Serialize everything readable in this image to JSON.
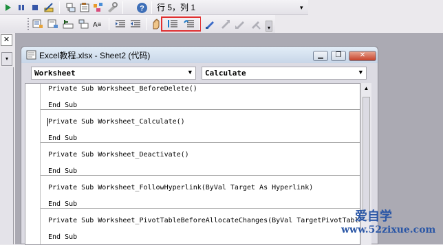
{
  "statusbar": {
    "position": "行 5，列 1"
  },
  "window": {
    "title": "Excel教程.xlsx - Sheet2 (代码)",
    "object_combo": "Worksheet",
    "procedure_combo": "Calculate",
    "minimize_glyph": "▁",
    "restore_glyph": "❐",
    "close_glyph": "✕"
  },
  "panel": {
    "close_glyph": "✕"
  },
  "code": {
    "lines": [
      "Private Sub Worksheet_BeforeDelete()",
      "End Sub",
      "Private Sub Worksheet_Calculate()",
      "End Sub",
      "Private Sub Worksheet_Deactivate()",
      "End Sub",
      "Private Sub Worksheet_FollowHyperlink(ByVal Target As Hyperlink)",
      "End Sub",
      "Private Sub Worksheet_PivotTableBeforeAllocateChanges(ByVal TargetPivotTable",
      "End Sub"
    ]
  },
  "watermark": {
    "line1": "爱自学",
    "line2": "www.52zixue.com"
  },
  "colors": {
    "highlight_box": "#e03030",
    "titlebar": "#d6e2f0",
    "close_button": "#c6422a"
  },
  "icons": [
    "run-icon",
    "pause-icon",
    "stop-icon",
    "design-mode-icon",
    "project-explorer-icon",
    "properties-icon",
    "object-browser-icon",
    "toolbox-icon",
    "help-icon",
    "list-properties-icon",
    "list-constants-icon",
    "quick-info-icon",
    "parameter-info-icon",
    "complete-word-icon",
    "indent-icon",
    "outdent-icon",
    "toggle-breakpoint-icon",
    "comment-block-icon",
    "uncomment-block-icon",
    "toggle-bookmark-icon",
    "next-bookmark-icon",
    "previous-bookmark-icon",
    "clear-bookmarks-icon"
  ]
}
